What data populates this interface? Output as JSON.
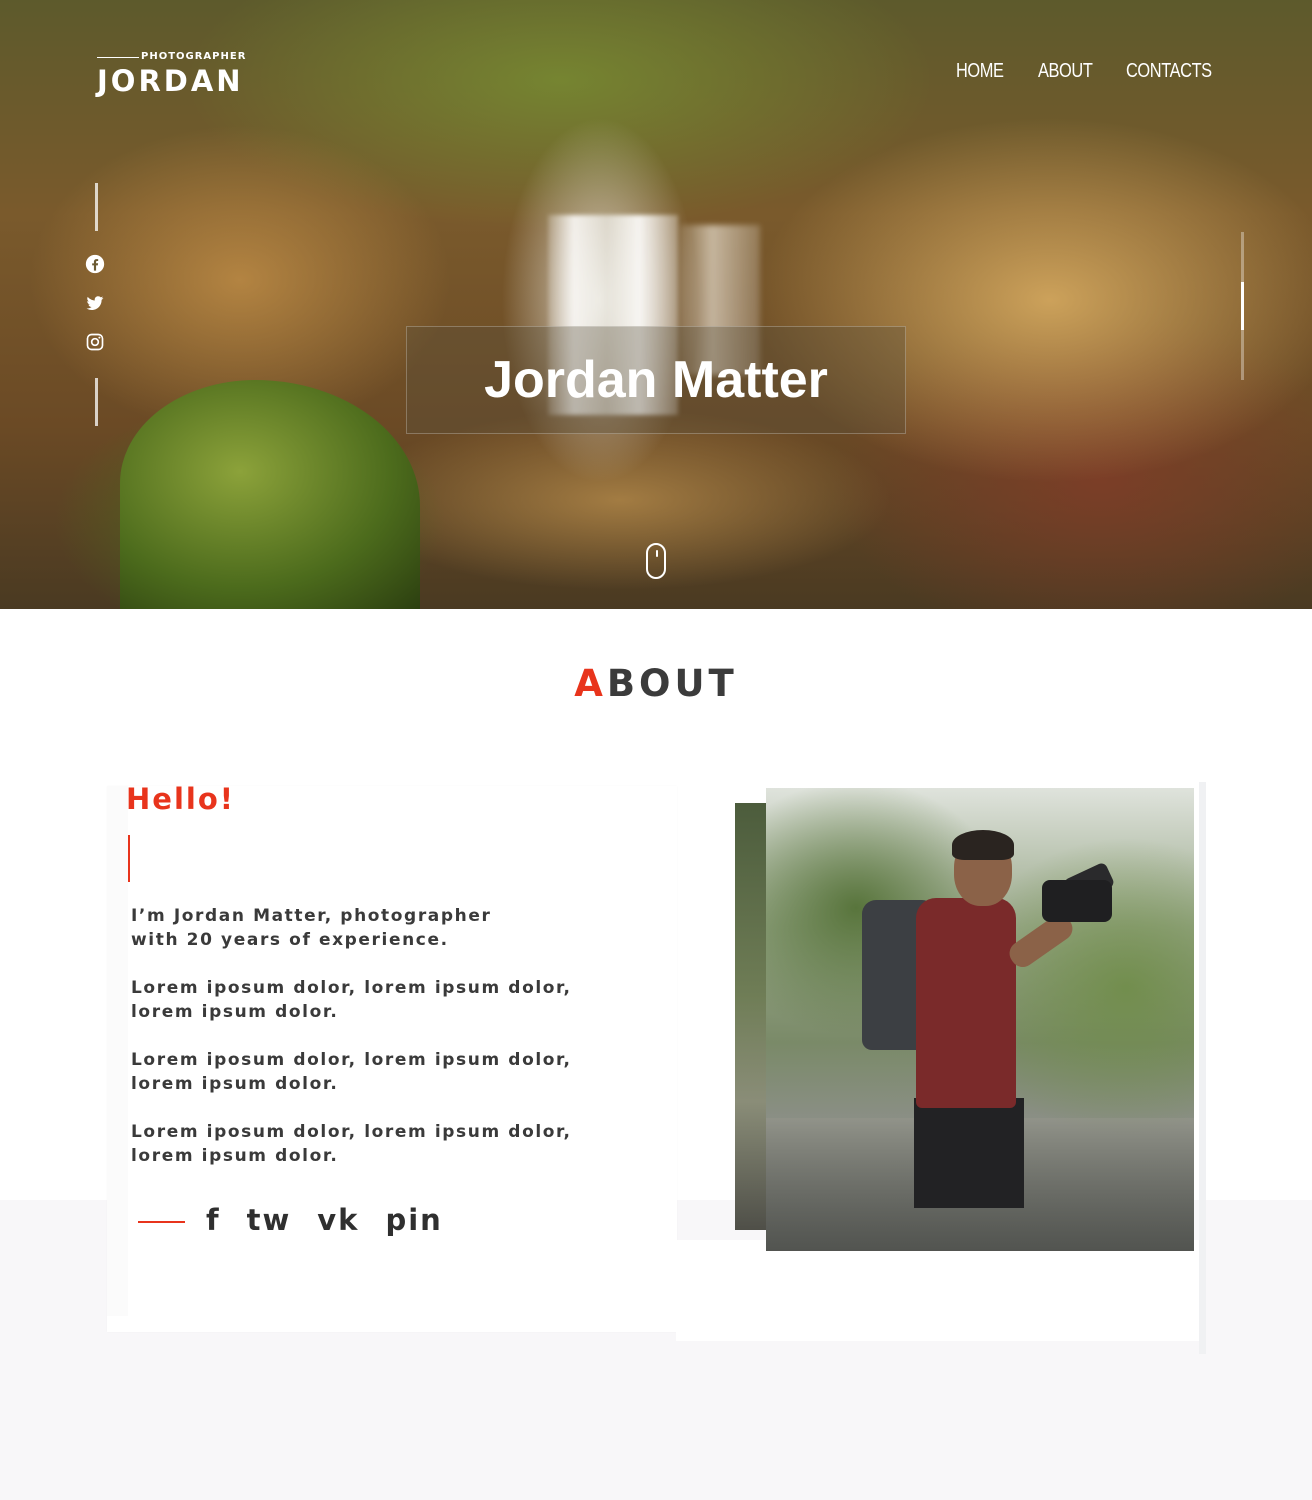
{
  "header": {
    "logo_sub": "PHOTOGRAPHER",
    "logo_main": "JORDAN",
    "nav": [
      "HOME",
      "ABOUT",
      "CONTACTS"
    ]
  },
  "hero": {
    "title": "Jordan Matter",
    "social_icons": [
      "facebook-icon",
      "twitter-icon",
      "instagram-icon"
    ],
    "slide_indicator": {
      "active": 2,
      "total": 3
    },
    "scroll_icon": "mouse-scroll-icon"
  },
  "about": {
    "title_first_letter": "A",
    "title_rest": "BOUT",
    "greeting": "Hello!",
    "paragraphs": [
      "I’m Jordan Matter, photographer\nwith 20 years of experience.",
      "Lorem iposum dolor, lorem ipsum dolor,\nlorem ipsum dolor.",
      "Lorem iposum dolor, lorem ipsum dolor,\nlorem ipsum dolor.",
      "Lorem iposum dolor, lorem ipsum dolor,\nlorem ipsum dolor."
    ],
    "share_links": [
      "f",
      "tw",
      "vk",
      "pin"
    ]
  },
  "colors": {
    "accent": "#e8341c",
    "text_dark": "#3a3a3a",
    "band": "#f8f7f9"
  }
}
